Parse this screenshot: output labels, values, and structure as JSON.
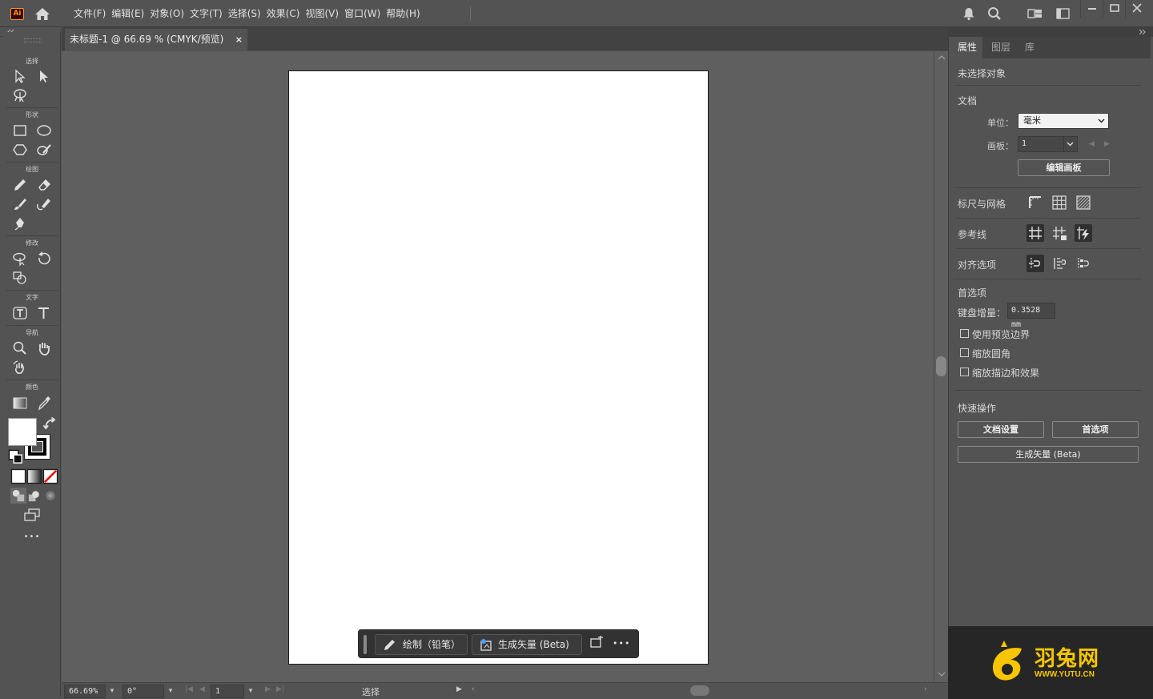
{
  "app": {
    "logo_text": "Ai"
  },
  "menu": {
    "items": [
      "文件(F)",
      "编辑(E)",
      "对象(O)",
      "文字(T)",
      "选择(S)",
      "效果(C)",
      "视图(V)",
      "窗口(W)",
      "帮助(H)"
    ]
  },
  "top_icons": [
    "bell-icon",
    "search-icon",
    "workspace-icon",
    "arrange-documents-icon"
  ],
  "window_controls": [
    "minimize-icon",
    "restore-icon",
    "close-icon"
  ],
  "document_tab": {
    "title": "未标题-1 @ 66.69 % (CMYK/预览)",
    "close": "×"
  },
  "toolbar": {
    "groups": {
      "select": "选择",
      "shape": "形状",
      "draw": "绘图",
      "modify": "修改",
      "type": "文字",
      "navigate": "导航",
      "color": "颜色"
    },
    "more": "•••"
  },
  "taskbar": {
    "draw_pencil": "绘制（铅笔）",
    "generate_vector": "生成矢量 (Beta)",
    "more": "•••"
  },
  "statusbar": {
    "zoom": "66.69%",
    "rotation": "0°",
    "artboard": "1",
    "tool": "选择"
  },
  "panel": {
    "tabs": [
      "属性",
      "图层",
      "库"
    ],
    "no_selection": "未选择对象",
    "document": {
      "title": "文档",
      "units_label": "单位：",
      "units_value": "毫米",
      "artboard_label": "画板：",
      "artboard_value": "1",
      "edit_artboards": "编辑画板"
    },
    "rulers_grids": "标尺与网格",
    "guides": "参考线",
    "align_options": "对齐选项",
    "preferences": {
      "title": "首选项",
      "keyboard_increment_label": "键盘增量：",
      "keyboard_increment_value": "0.3528 mm",
      "preview_bounds": "使用预览边界",
      "scale_corners": "缩放圆角",
      "scale_strokes": "缩放描边和效果"
    },
    "quick_actions": {
      "title": "快速操作",
      "doc_setup": "文档设置",
      "preferences": "首选项",
      "generate_vector": "生成矢量 (Beta)"
    }
  },
  "watermark": {
    "brand": "羽兔网",
    "url": "WWW.YUTU.CN"
  }
}
